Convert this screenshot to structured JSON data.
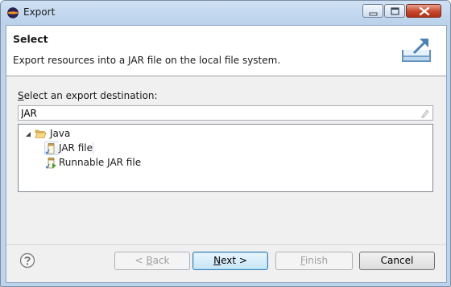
{
  "window": {
    "title": "Export"
  },
  "header": {
    "title": "Select",
    "description": "Export resources into a JAR file on the local file system."
  },
  "destination": {
    "label_mnemonic": "S",
    "label_rest": "elect an export destination:",
    "filter_value": "JAR"
  },
  "tree": {
    "items": [
      {
        "label": "Java",
        "icon": "folder-open-icon",
        "expanded": true
      },
      {
        "label": "JAR file",
        "icon": "jar-file-icon",
        "selected": true
      },
      {
        "label": "Runnable JAR file",
        "icon": "runnable-jar-icon"
      }
    ]
  },
  "buttons": {
    "back_mnemonic": "B",
    "back_prefix": "< ",
    "back_rest": "ack",
    "next_mnemonic": "N",
    "next_rest": "ext >",
    "finish_mnemonic": "F",
    "finish_rest": "inish",
    "cancel": "Cancel"
  },
  "colors": {
    "titlebar": "#bcd4ec",
    "close_button": "#c9462c",
    "default_button_border": "#3c7fb1"
  }
}
